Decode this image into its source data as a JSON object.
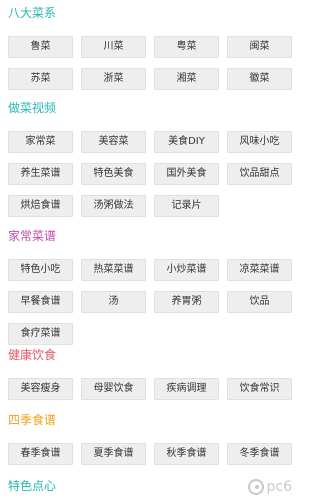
{
  "colors": {
    "eight_cuisines": "#27b7b3",
    "cooking_video": "#27b7b3",
    "home_recipes": "#c04fa7",
    "healthy_diet": "#e2586a",
    "seasonal": "#f0a21a",
    "special_snacks": "#27b7b3",
    "watermark": "#c9c9c9"
  },
  "sections": [
    {
      "title": "八大菜系",
      "items": [
        "鲁菜",
        "川菜",
        "粤菜",
        "闽菜",
        "苏菜",
        "浙菜",
        "湘菜",
        "徽菜"
      ]
    },
    {
      "title": "做菜视频",
      "items": [
        "家常菜",
        "美容菜",
        "美食DIY",
        "风味小吃",
        "养生菜谱",
        "特色美食",
        "国外美食",
        "饮品甜点",
        "烘焙食谱",
        "汤粥做法",
        "记录片"
      ]
    },
    {
      "title": "家常菜谱",
      "items": [
        "特色小吃",
        "热菜菜谱",
        "小炒菜谱",
        "凉菜菜谱",
        "早餐食谱",
        "汤",
        "养胃粥",
        "饮品",
        "食疗菜谱"
      ]
    },
    {
      "title": "健康饮食",
      "items": [
        "美容瘦身",
        "母婴饮食",
        "疾病调理",
        "饮食常识"
      ]
    },
    {
      "title": "四季食谱",
      "items": [
        "春季食谱",
        "夏季食谱",
        "秋季食谱",
        "冬季食谱"
      ]
    },
    {
      "title": "特色点心",
      "items": []
    }
  ],
  "watermark": {
    "icon": "pc6-logo-icon",
    "text": "pc6"
  }
}
